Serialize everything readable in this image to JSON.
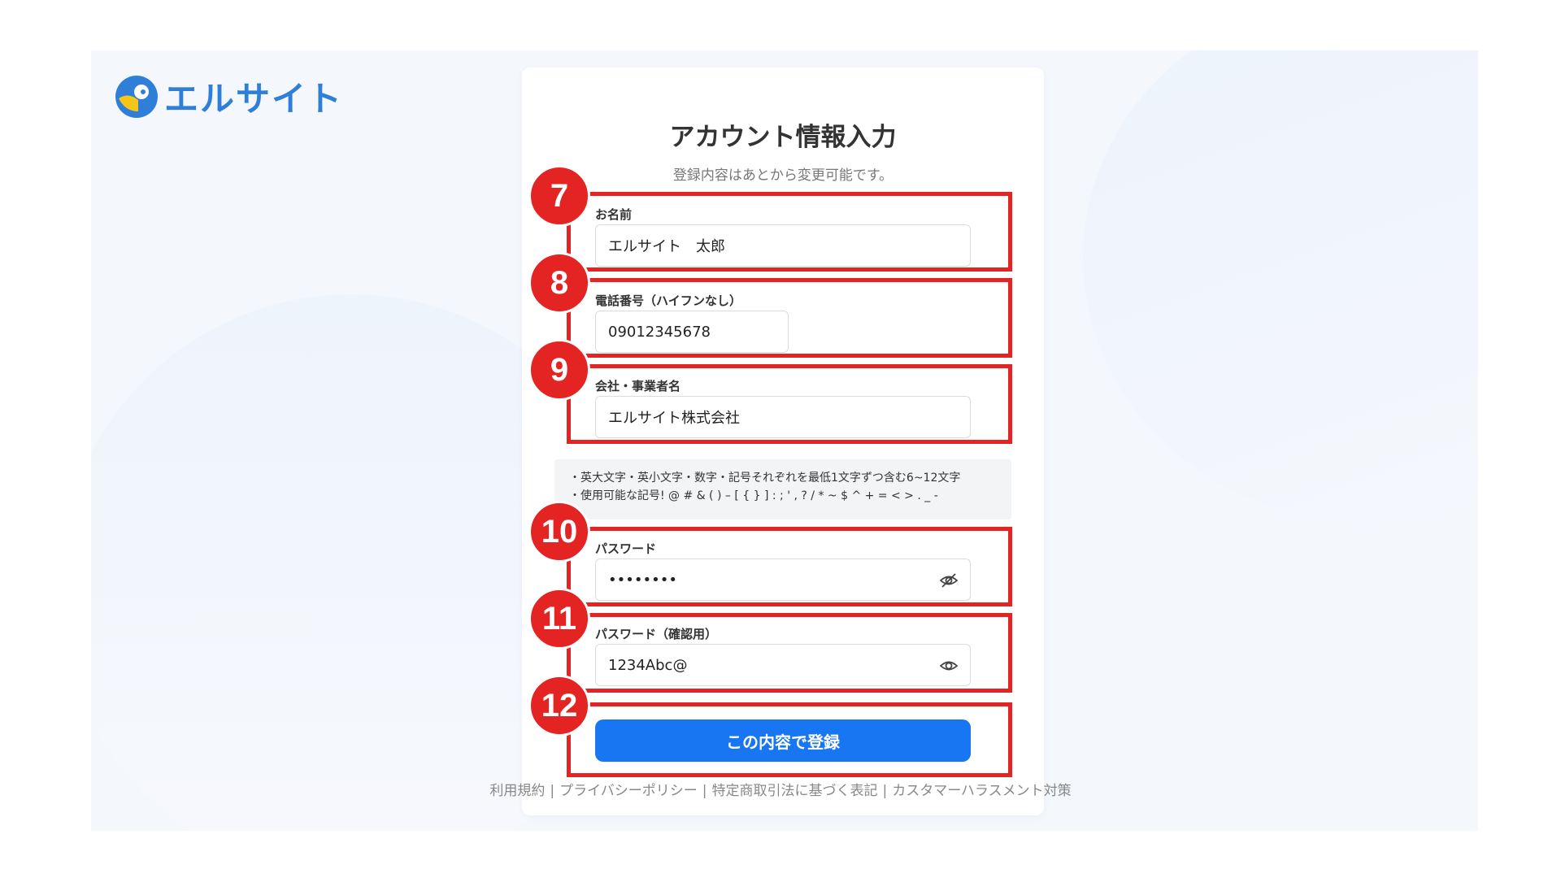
{
  "brand": {
    "name": "エルサイト"
  },
  "form": {
    "title": "アカウント情報入力",
    "subtitle": "登録内容はあとから変更可能です。",
    "name": {
      "label": "お名前",
      "value": "エルサイト　太郎"
    },
    "phone": {
      "label": "電話番号（ハイフンなし）",
      "value": "09012345678"
    },
    "company": {
      "label": "会社・事業者名",
      "value": "エルサイト株式会社"
    },
    "password_rules": [
      "・英大文字・英小文字・数字・記号それぞれを最低1文字ずつ含む6~12文字",
      "・使用可能な記号! @ # & ( ) – [ { } ] : ; ' , ? / * ~ $ ^ + = < > . _ -"
    ],
    "password": {
      "label": "パスワード",
      "value": "••••••••"
    },
    "password_confirm": {
      "label": "パスワード（確認用）",
      "value": "1234Abc@"
    },
    "submit_label": "この内容で登録"
  },
  "footer": {
    "links": [
      "利用規約",
      "プライバシーポリシー",
      "特定商取引法に基づく表記",
      "カスタマーハラスメント対策"
    ],
    "separator": "|"
  },
  "annotations": [
    "7",
    "8",
    "9",
    "10",
    "11",
    "12"
  ],
  "colors": {
    "accent": "#1976f2",
    "annotation": "#e42323",
    "brand": "#2f7fd8"
  }
}
